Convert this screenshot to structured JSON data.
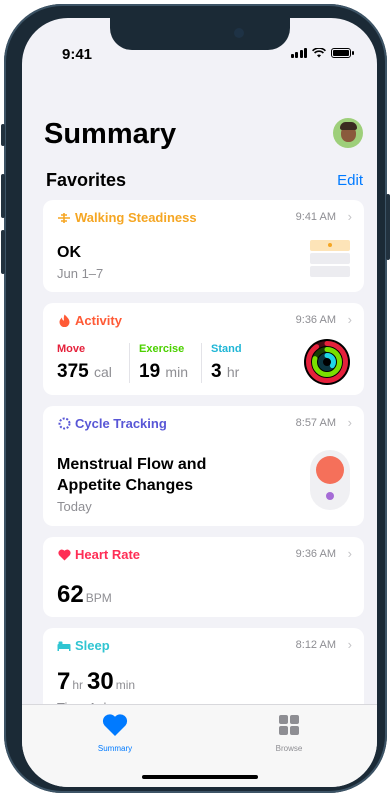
{
  "status_bar": {
    "time": "9:41"
  },
  "header": {
    "title": "Summary"
  },
  "favorites": {
    "title": "Favorites",
    "edit_label": "Edit"
  },
  "cards": {
    "walking": {
      "title": "Walking Steadiness",
      "time": "9:41 AM",
      "value": "OK",
      "subtitle": "Jun 1–7",
      "color": "#f5a623"
    },
    "activity": {
      "title": "Activity",
      "time": "9:36 AM",
      "color": "#ff5a36",
      "move": {
        "label": "Move",
        "value": "375",
        "unit": "cal",
        "color": "#e5213b"
      },
      "exercise": {
        "label": "Exercise",
        "value": "19",
        "unit": "min",
        "color": "#4cd100"
      },
      "stand": {
        "label": "Stand",
        "value": "3",
        "unit": "hr",
        "color": "#1fb6d6"
      }
    },
    "cycle": {
      "title": "Cycle Tracking",
      "time": "8:57 AM",
      "line1": "Menstrual Flow and",
      "line2": "Appetite Changes",
      "subtitle": "Today",
      "color": "#5856d6"
    },
    "heart": {
      "title": "Heart Rate",
      "time": "9:36 AM",
      "value": "62",
      "unit": "BPM",
      "color": "#ff2d55"
    },
    "sleep": {
      "title": "Sleep",
      "time": "8:12 AM",
      "hours": "7",
      "hours_unit": "hr",
      "minutes": "30",
      "minutes_unit": "min",
      "subtitle": "Time Asleep",
      "color": "#30c5d2"
    }
  },
  "tab_bar": {
    "tabs": [
      {
        "label": "Summary",
        "icon": "heart-icon",
        "active": true
      },
      {
        "label": "Browse",
        "icon": "grid-icon",
        "active": false
      }
    ],
    "active_color": "#007aff"
  }
}
